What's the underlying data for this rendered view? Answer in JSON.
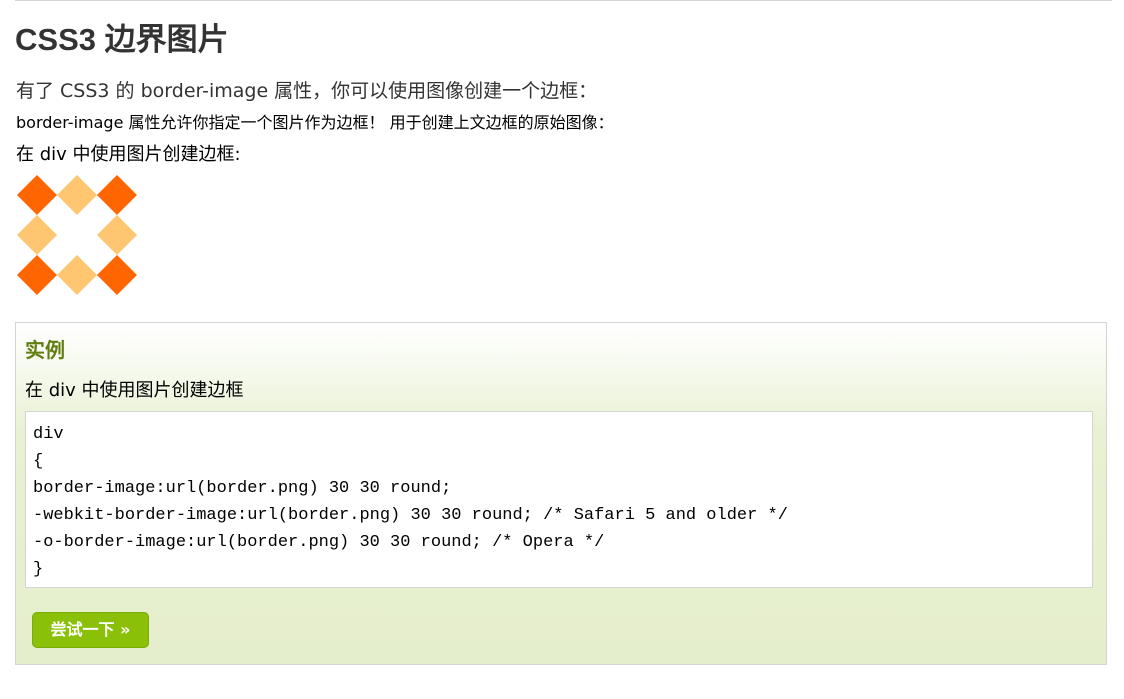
{
  "page": {
    "title": "CSS3 边界图片",
    "intro": "有了 CSS3 的 border-image 属性，你可以使用图像创建一个边框：",
    "note": "border-image 属性允许你指定一个图片作为边框！ 用于创建上文边框的原始图像：",
    "demo_caption": "在 div 中使用图片创建边框:"
  },
  "border_image": {
    "dark_color": "#ff6600",
    "light_color": "#ffc672"
  },
  "example": {
    "heading": "实例",
    "description": "在 div 中使用图片创建边框",
    "code_lines": [
      "div",
      "{",
      "border-image:url(border.png) 30 30 round;",
      "-webkit-border-image:url(border.png) 30 30 round; /* Safari 5 and older */",
      "-o-border-image:url(border.png) 30 30 round; /* Opera */",
      "}"
    ],
    "try_button_label": "尝试一下 »",
    "accent_color": "#8ac007",
    "heading_color": "#617f10"
  }
}
